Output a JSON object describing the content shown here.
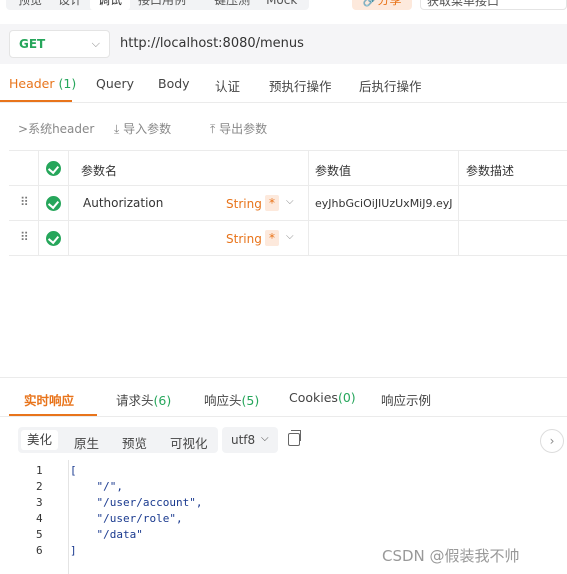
{
  "top_tabs": {
    "items": [
      "预览",
      "设计",
      "调试",
      "接口用例",
      "一键压测",
      "Mock"
    ],
    "active_index": 2,
    "share_label": "🔗分享",
    "api_name": "获取菜单接口"
  },
  "url_bar": {
    "method": "GET",
    "url": "http://localhost:8080/menus"
  },
  "request_tabs": {
    "header_label": "Header",
    "header_count": "(1)",
    "query": "Query",
    "body": "Body",
    "auth": "认证",
    "pre_ops": "预执行操作",
    "post_ops": "后执行操作"
  },
  "toolbar": {
    "system_header": "系统header",
    "import": "导入参数",
    "export": "导出参数"
  },
  "params_table": {
    "headers": {
      "name": "参数名",
      "value": "参数值",
      "desc": "参数描述"
    },
    "rows": [
      {
        "name": "Authorization",
        "type": "String",
        "required": "*",
        "value": "eyJhbGciOiJIUzUxMiJ9.eyJ",
        "desc": ""
      },
      {
        "name": "",
        "type": "String",
        "required": "*",
        "value": "",
        "desc": ""
      }
    ]
  },
  "response_tabs": {
    "realtime": "实时响应",
    "req_headers": "请求头",
    "req_headers_count": "(6)",
    "resp_headers": "响应头",
    "resp_headers_count": "(5)",
    "cookies": "Cookies",
    "cookies_count": "(0)",
    "example": "响应示例"
  },
  "response_toolbar": {
    "beautify": "美化",
    "raw": "原生",
    "preview": "预览",
    "visualize": "可视化",
    "encoding": "utf8"
  },
  "code": {
    "line_numbers": [
      "1",
      "2",
      "3",
      "4",
      "5",
      "6"
    ],
    "lines": [
      "[",
      "    \"/\",",
      "    \"/user/account\",",
      "    \"/user/role\",",
      "    \"/data\"",
      "]"
    ]
  },
  "watermark": "CSDN @假装我不帅",
  "colors": {
    "accent": "#e8741b",
    "green": "#26a65b"
  }
}
